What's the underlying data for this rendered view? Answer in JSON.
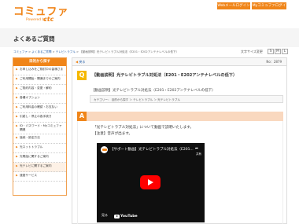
{
  "header": {
    "logo_text": "コミュファ",
    "logo_sub": "Powered by",
    "logo_brand": "ctc",
    "web_mail_btn": "Webメールログイン",
    "my_commufa_btn": "Myコミュファログイン"
  },
  "page_title": "よくあるご質問",
  "breadcrumb": {
    "items": [
      "コミュファ",
      "よくあるご質問",
      "テレビトラブル",
      "【動画説明】光テレビトラブル対処法（E201・E202アンテナレベルの低下）"
    ],
    "separator": " > "
  },
  "font_size": {
    "label": "文字サイズ変更",
    "small": "S",
    "medium": "M",
    "large": "L"
  },
  "sidebar": {
    "heading": "目的から探す",
    "items": [
      {
        "label": "お申し込みをご検討中の皆様さま"
      },
      {
        "label": "ご利用開始・開通までのご案内"
      },
      {
        "label": "ご契約内容・変更・解約"
      },
      {
        "label": "各種オプション"
      },
      {
        "label": "ご利用料金の確認・お支払い"
      },
      {
        "label": "引越し・停止の各手続き"
      },
      {
        "label": "ID・パスワード・Myコミュファ関連"
      },
      {
        "label": "接続・設定方法"
      },
      {
        "label": "光ネットトラブル"
      },
      {
        "label": "光電話に関するご案内"
      },
      {
        "label": "光テレビに関するご案内"
      },
      {
        "label": "速度サービス"
      }
    ]
  },
  "main": {
    "back_label": "戻る",
    "question_no": "No：2879",
    "q_badge": "Q",
    "q_title": "【動画説明】光テレビトラブル対処法（E201・E202アンテナレベルの低下）",
    "q_subtitle": "【動画説明】光テレビトラブル対処法（E201・E202アンテナレベルの低下）",
    "category_path": "カテゴリー： 目的から探す ＞ テレビトラブル ＞ 光テレビトラブル",
    "a_badge": "A",
    "answer_line1": "「光テレビトラブル対処法」について動画で説明いたします。",
    "answer_line2": "【注意】音声が出ます。",
    "video": {
      "title": "【サポート動画】光テレビトラブル対処法（E201...",
      "share_label": "共有",
      "watch_label": "見る",
      "yt_label": "YouTube"
    }
  },
  "colors": {
    "brand_orange": "#f08519",
    "q_yellow": "#f5b800",
    "answer_band": "#f9d8bf",
    "link_blue": "#1a57a6",
    "yt_red": "#ff0000"
  }
}
